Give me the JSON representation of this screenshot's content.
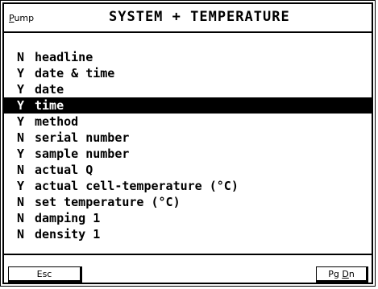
{
  "header": {
    "mode_label_first": "P",
    "mode_label_rest": "ump",
    "title": "SYSTEM + TEMPERATURE"
  },
  "list": {
    "selected_index": 3,
    "items": [
      {
        "flag": "N",
        "label": "headline"
      },
      {
        "flag": "Y",
        "label": "date & time"
      },
      {
        "flag": "Y",
        "label": "date"
      },
      {
        "flag": "Y",
        "label": "time"
      },
      {
        "flag": "Y",
        "label": "method"
      },
      {
        "flag": "N",
        "label": "serial number"
      },
      {
        "flag": "Y",
        "label": "sample number"
      },
      {
        "flag": "N",
        "label": "actual Q"
      },
      {
        "flag": "Y",
        "label": "actual cell-temperature (°C)"
      },
      {
        "flag": "N",
        "label": "set temperature (°C)"
      },
      {
        "flag": "N",
        "label": "damping 1"
      },
      {
        "flag": "N",
        "label": "density 1"
      }
    ]
  },
  "footer": {
    "esc_label": "Esc",
    "pgdn_prefix": "Pg ",
    "pgdn_underlined": "D",
    "pgdn_suffix": "n"
  },
  "colors": {
    "foreground": "#000000",
    "background": "#ffffff",
    "selection_bg": "#000000",
    "selection_fg": "#ffffff"
  }
}
